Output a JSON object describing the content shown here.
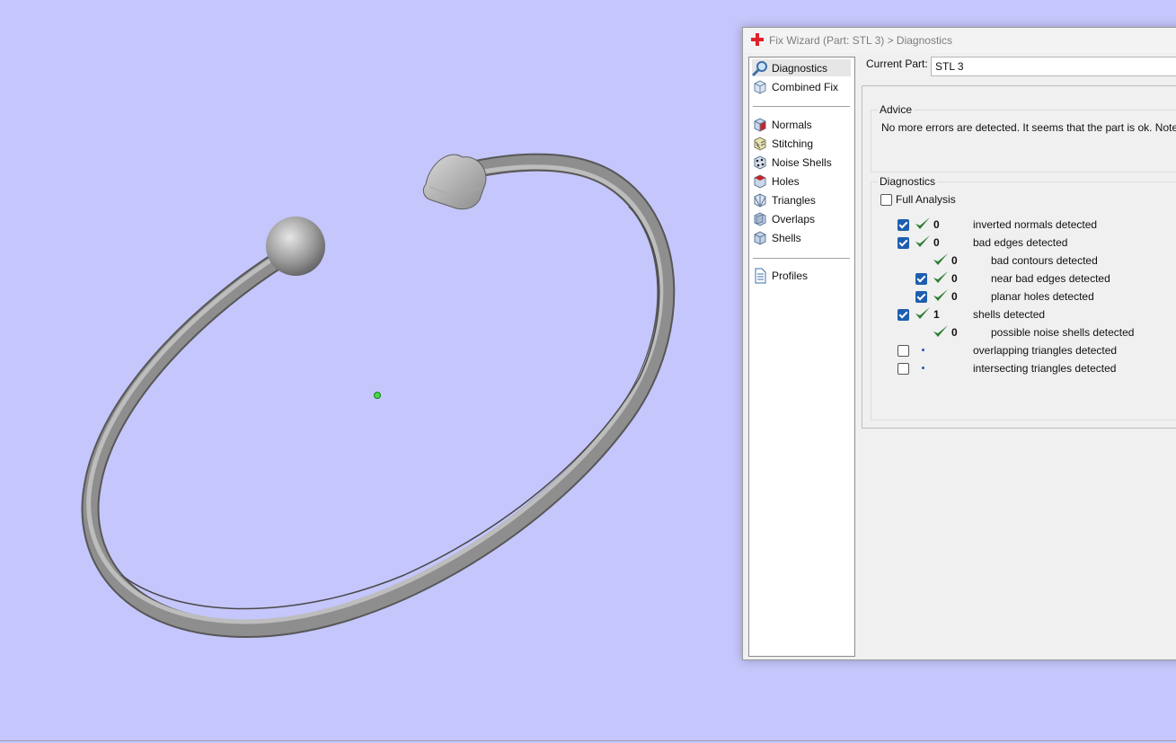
{
  "window": {
    "title": "Fix Wizard (Part: STL 3) > Diagnostics"
  },
  "nav": {
    "items": [
      {
        "label": "Diagnostics",
        "icon": "magnifier-icon",
        "selected": true
      },
      {
        "label": "Combined Fix",
        "icon": "cube-icon"
      },
      {
        "label": "Normals",
        "icon": "normals-cube-icon"
      },
      {
        "label": "Stitching",
        "icon": "stitching-cube-icon"
      },
      {
        "label": "Noise Shells",
        "icon": "noise-shells-icon"
      },
      {
        "label": "Holes",
        "icon": "holes-cube-icon"
      },
      {
        "label": "Triangles",
        "icon": "triangles-cube-icon"
      },
      {
        "label": "Overlaps",
        "icon": "overlaps-cube-icon"
      },
      {
        "label": "Shells",
        "icon": "shells-cube-icon"
      },
      {
        "label": "Profiles",
        "icon": "document-icon"
      }
    ]
  },
  "current_part": {
    "label": "Current Part:",
    "value": "STL 3"
  },
  "advice": {
    "title": "Advice",
    "text": "No more errors are detected. It seems that the part is ok. Note that"
  },
  "diagnostics": {
    "title": "Diagnostics",
    "full_analysis_label": "Full Analysis",
    "full_analysis_checked": false,
    "rows": [
      {
        "checkbox": true,
        "checked": true,
        "status": "ok",
        "count": "0",
        "label": "inverted normals detected",
        "indent": 0
      },
      {
        "checkbox": true,
        "checked": true,
        "status": "ok",
        "count": "0",
        "label": "bad edges detected",
        "indent": 0
      },
      {
        "checkbox": false,
        "checked": false,
        "status": "ok",
        "count": "0",
        "label": "bad contours detected",
        "indent": 1
      },
      {
        "checkbox": true,
        "checked": true,
        "status": "ok",
        "count": "0",
        "label": "near bad edges detected",
        "indent": 1
      },
      {
        "checkbox": true,
        "checked": true,
        "status": "ok",
        "count": "0",
        "label": "planar holes detected",
        "indent": 1
      },
      {
        "checkbox": true,
        "checked": true,
        "status": "ok",
        "count": "1",
        "label": "shells detected",
        "indent": 0
      },
      {
        "checkbox": false,
        "checked": false,
        "status": "ok",
        "count": "0",
        "label": "possible noise shells detected",
        "indent": 1
      },
      {
        "checkbox": true,
        "checked": false,
        "status": "pending",
        "count": "",
        "label": "overlapping triangles detected",
        "indent": 0
      },
      {
        "checkbox": true,
        "checked": false,
        "status": "pending",
        "count": "",
        "label": "intersecting triangles detected",
        "indent": 0
      }
    ]
  },
  "colors": {
    "viewport_background": "#c5c6fb",
    "check_green": "#2e7d32",
    "checkbox_blue": "#1e5eb0",
    "app_icon_red": "#e0202a"
  }
}
